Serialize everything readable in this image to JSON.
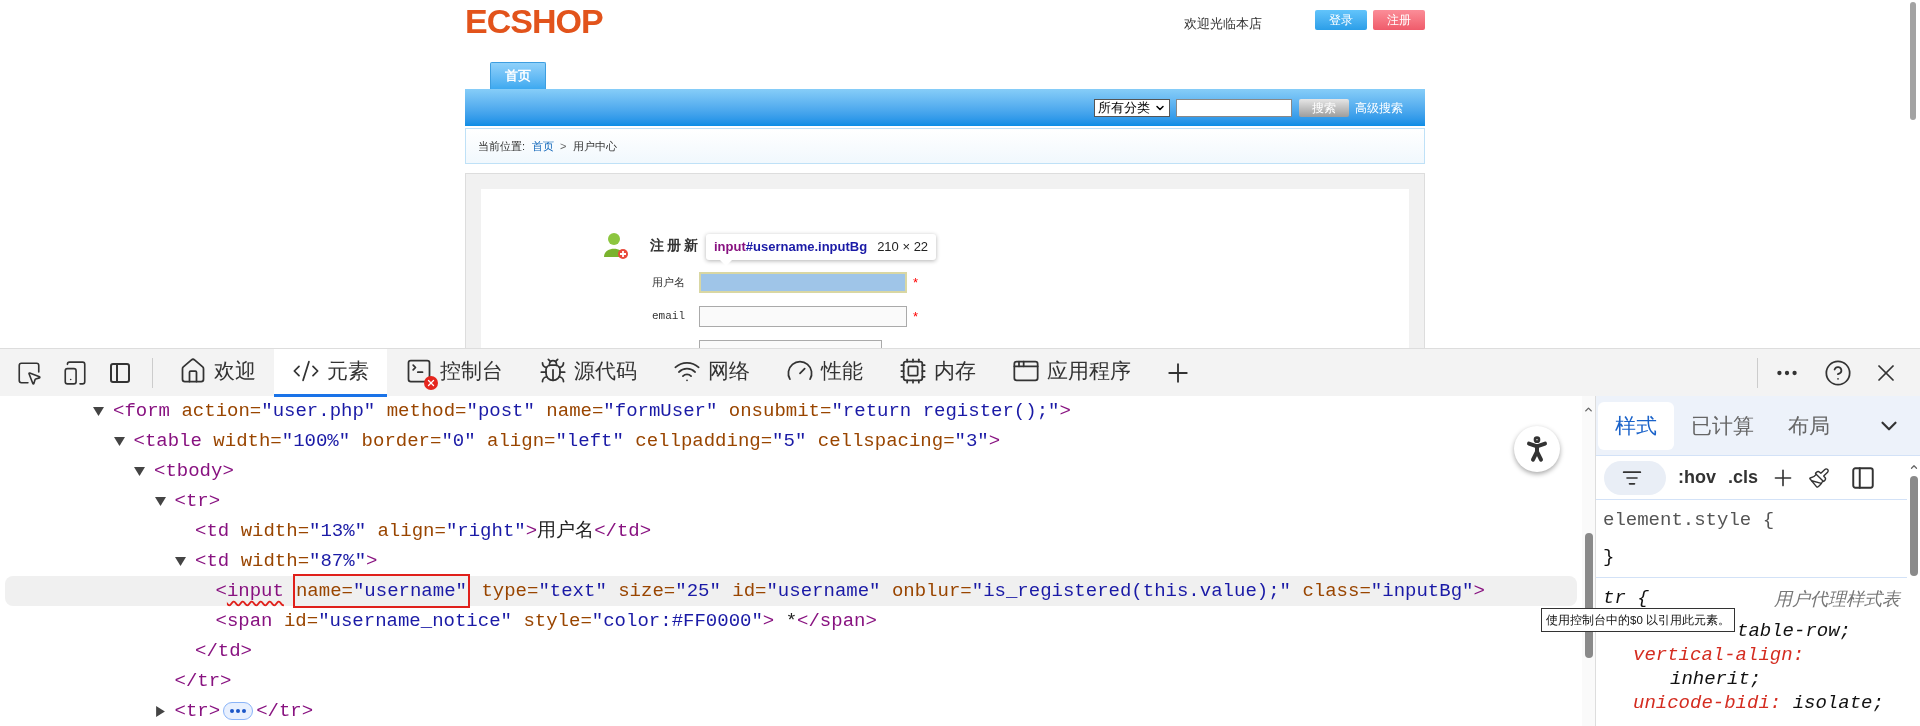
{
  "page": {
    "logo": "ECSHOP",
    "welcome": "欢迎光临本店",
    "header_buttons": [
      {
        "label": "登录",
        "kind": "login"
      },
      {
        "label": "注册",
        "kind": "register"
      }
    ],
    "nav_tabs": [
      {
        "label": "首页",
        "selected": true
      }
    ],
    "search": {
      "category": "所有分类",
      "button": "搜索",
      "advanced_link": "高级搜索"
    },
    "breadcrumb": {
      "label": "当前位置:",
      "home": "首页",
      "separator": ">",
      "current": "用户中心"
    },
    "form": {
      "heading": "注册新",
      "fields": [
        {
          "label": "用户名",
          "required_mark": "*",
          "highlighted": true,
          "kind": "text"
        },
        {
          "label": "email",
          "required_mark": "*",
          "highlighted": false,
          "kind": "mono"
        },
        {
          "kind": "partial",
          "highlighted": false
        }
      ]
    },
    "inspect_tooltip": {
      "tag": "input",
      "selector": "#username.inputBg",
      "size": "210 × 22"
    }
  },
  "devtools": {
    "tabs": [
      {
        "label": "欢迎",
        "selected": false,
        "error": false
      },
      {
        "label": "元素",
        "selected": true,
        "error": false
      },
      {
        "label": "控制台",
        "selected": false,
        "error": true
      },
      {
        "label": "源代码",
        "selected": false,
        "error": false
      },
      {
        "label": "网络",
        "selected": false,
        "error": false
      },
      {
        "label": "性能",
        "selected": false,
        "error": false
      },
      {
        "label": "内存",
        "selected": false,
        "error": false
      },
      {
        "label": "应用程序",
        "selected": false,
        "error": false
      }
    ],
    "nodes": [
      {
        "segments": [
          {
            "text": "<form action=\"user.php\" method=\"post\" name=\"formUser\" onsubmit=\"return register();\">"
          }
        ],
        "expanded": true,
        "selected": false,
        "children": [
          {
            "segments": [
              {
                "text": "<table width=\"100%\" border=\"0\" align=\"left\" cellpadding=\"5\" cellspacing=\"3\">"
              }
            ],
            "expanded": true,
            "selected": false,
            "children": [
              {
                "segments": [
                  {
                    "text": "<tbody>"
                  }
                ],
                "expanded": true,
                "selected": false,
                "children": [
                  {
                    "segments": [
                      {
                        "text": "<tr>"
                      }
                    ],
                    "expanded": true,
                    "selected": false,
                    "close": "</tr>",
                    "children": [
                      {
                        "segments": [
                          {
                            "text": "<td width=\"13%\" align=\"right\">用户名</td>"
                          }
                        ],
                        "selected": false
                      },
                      {
                        "segments": [
                          {
                            "text": "<td width=\"87%\">"
                          }
                        ],
                        "expanded": true,
                        "selected": false,
                        "close": "</td>",
                        "children": [
                          {
                            "segments": [
                              {
                                "text": "<",
                                "kind": "code"
                              },
                              {
                                "text": "input",
                                "kind": "wavy"
                              },
                              {
                                "text": "name=\"username\"",
                                "kind": "boxed"
                              },
                              {
                                "text": " type=\"text\" size=\"25\" id=\"username\" onblur=\"is_registered(this.value);\" class=\"inputBg\">",
                                "kind": "code"
                              }
                            ],
                            "selected": true
                          },
                          {
                            "segments": [
                              {
                                "text": "<span id=\"username_notice\" style=\"color:#FF0000\"> *</span>"
                              }
                            ],
                            "selected": false
                          }
                        ]
                      }
                    ]
                  },
                  {
                    "segments": [
                      {
                        "text": "<tr>"
                      }
                    ],
                    "expanded": false,
                    "selected": false,
                    "close": "</tr>"
                  }
                ]
              }
            ]
          }
        ]
      }
    ],
    "hint_tooltip": "使用控制台中的$0 以引用此元素。",
    "styles": {
      "tabs": [
        {
          "label": "样式",
          "selected": true
        },
        {
          "label": "已计算",
          "selected": false
        },
        {
          "label": "布局",
          "selected": false
        }
      ],
      "hov": ":hov",
      "cls": ".cls",
      "rules": [
        {
          "selector": "element.style {",
          "close": "}",
          "kind": "inline"
        },
        {
          "selector": "tr {",
          "origin": "用户代理样式表",
          "kind": "user_agent",
          "declarations": [
            {
              "value": "table-row;"
            },
            {
              "property": "vertical-align:",
              "value": "inherit;"
            },
            {
              "property": "unicode-bidi:",
              "value": "isolate;"
            }
          ]
        }
      ]
    }
  }
}
